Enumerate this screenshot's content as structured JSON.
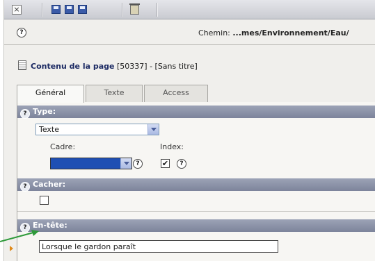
{
  "toolbar": {
    "close_icon": "close-icon",
    "save_icons": [
      "save-icon",
      "save-view-icon",
      "save-close-icon"
    ],
    "delete_icon": "trash-icon"
  },
  "path": {
    "label": "Chemin: ",
    "value": "...mes/Environnement/Eau/"
  },
  "record": {
    "title": "Contenu de la page",
    "meta": " [50337] - [Sans titre]"
  },
  "tabs": [
    {
      "label": "Général"
    },
    {
      "label": "Texte"
    },
    {
      "label": "Access"
    }
  ],
  "sections": {
    "type": {
      "header": "Type:",
      "selected": "Texte",
      "cadre_label": "Cadre:",
      "index_label": "Index:",
      "index_checked": "✔"
    },
    "cacher": {
      "header": "Cacher:"
    },
    "entete": {
      "header": "En-tête:",
      "value": "Lorsque le gardon paraît"
    }
  },
  "help_glyph": "?",
  "colors": {
    "section_header": "#8a91a7",
    "title_text": "#1c2a63",
    "annotation_arrow": "#2e9a3a",
    "cadre_select_fill": "#1f4fb3"
  }
}
